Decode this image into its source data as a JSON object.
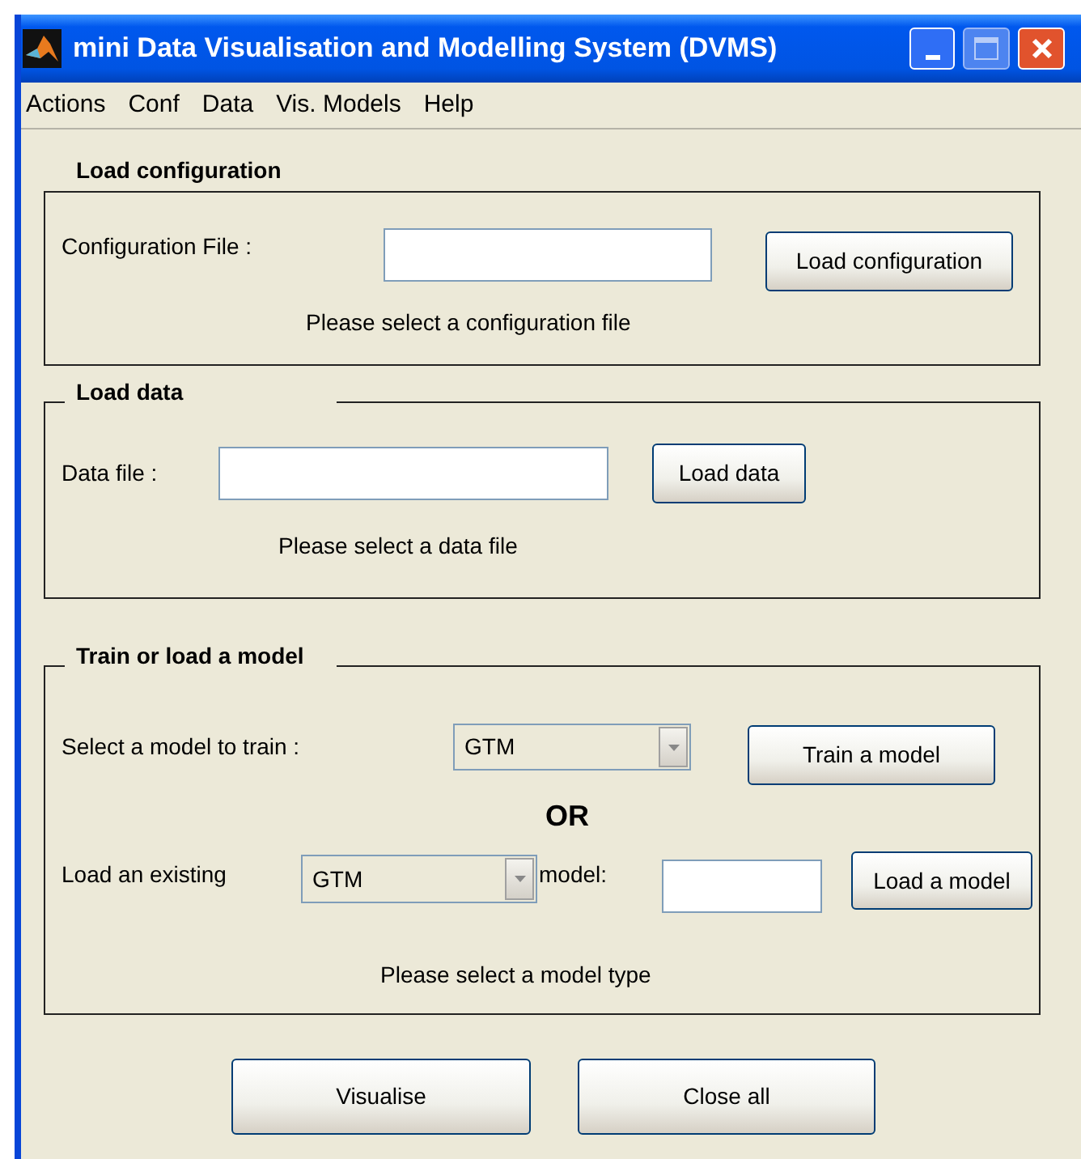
{
  "window": {
    "title": "mini Data Visualisation and Modelling System (DVMS)"
  },
  "menu": [
    "Actions",
    "Conf",
    "Data",
    "Vis. Models",
    "Help"
  ],
  "load_configuration": {
    "title": "Load configuration",
    "label": "Configuration File :",
    "button": "Load configuration",
    "status": "Please select a configuration file"
  },
  "load_data": {
    "title": "Load data",
    "label": "Data file :",
    "button": "Load data",
    "status": "Please select a data file"
  },
  "model": {
    "title": "Train or load a model",
    "train_label": "Select a model to train :",
    "train_select": "GTM",
    "train_button": "Train a model",
    "or": "OR",
    "load_label": "Load an existing",
    "load_select": "GTM",
    "load_suffix": "model:",
    "load_button": "Load a model",
    "status": "Please select a model type"
  },
  "buttons": [
    "Visualise",
    "Close all"
  ]
}
